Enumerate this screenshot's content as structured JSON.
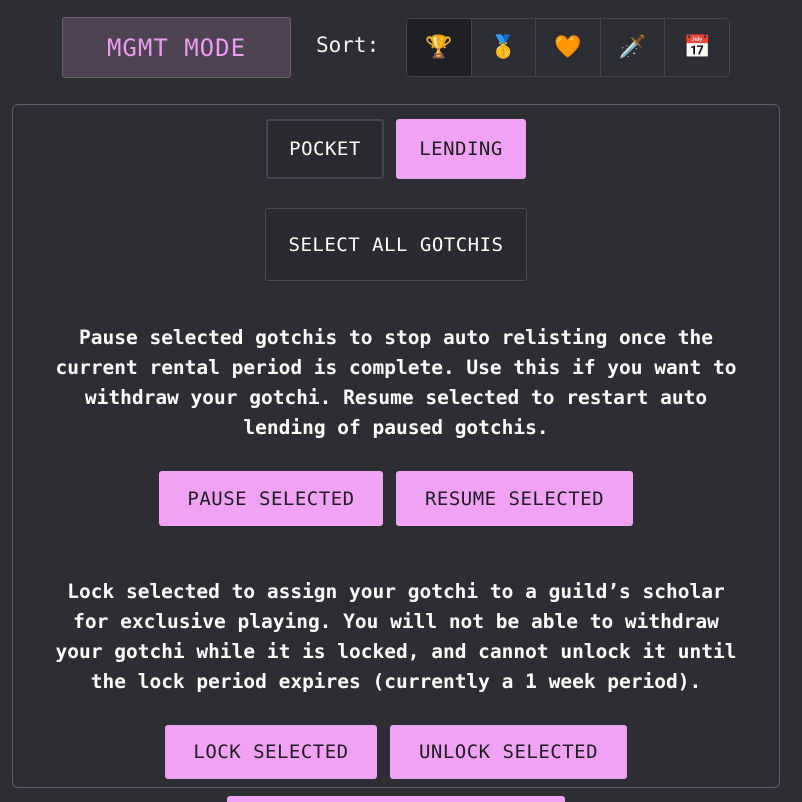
{
  "header": {
    "mode_label": "MGMT MODE",
    "sort_label": "Sort:",
    "sort_options": [
      {
        "icon": "trophy-icon",
        "glyph": "🏆",
        "active": true
      },
      {
        "icon": "medal-icon",
        "glyph": "🥇",
        "active": false
      },
      {
        "icon": "orange-heart-icon",
        "glyph": "🧡",
        "active": false
      },
      {
        "icon": "dagger-icon",
        "glyph": "🗡️",
        "active": false
      },
      {
        "icon": "calendar-icon",
        "glyph": "📅",
        "active": false
      }
    ]
  },
  "tabs": {
    "pocket": "POCKET",
    "lending": "LENDING"
  },
  "select_all": "SELECT ALL GOTCHIS",
  "pause_section": {
    "lines": [
      "Pause selected gotchis to stop auto relisting once the",
      "current rental period is complete. Use this if you want to",
      "withdraw your gotchi. Resume selected to restart auto",
      "lending of paused gotchis."
    ],
    "pause_button": "PAUSE SELECTED",
    "resume_button": "RESUME SELECTED"
  },
  "lock_section": {
    "lines": [
      "Lock selected to assign your gotchi to a guild’s scholar",
      "for exclusive playing. You will not be able to withdraw",
      "your gotchi while it is locked, and cannot unlock it until",
      "the lock period expires (currently a 1 week period)."
    ],
    "lock_button": "LOCK SELECTED",
    "unlock_button": "UNLOCK SELECTED"
  },
  "colors": {
    "accent": "#f0a3f3",
    "background": "#2d2e33",
    "mode_text": "#ec9cf0"
  }
}
